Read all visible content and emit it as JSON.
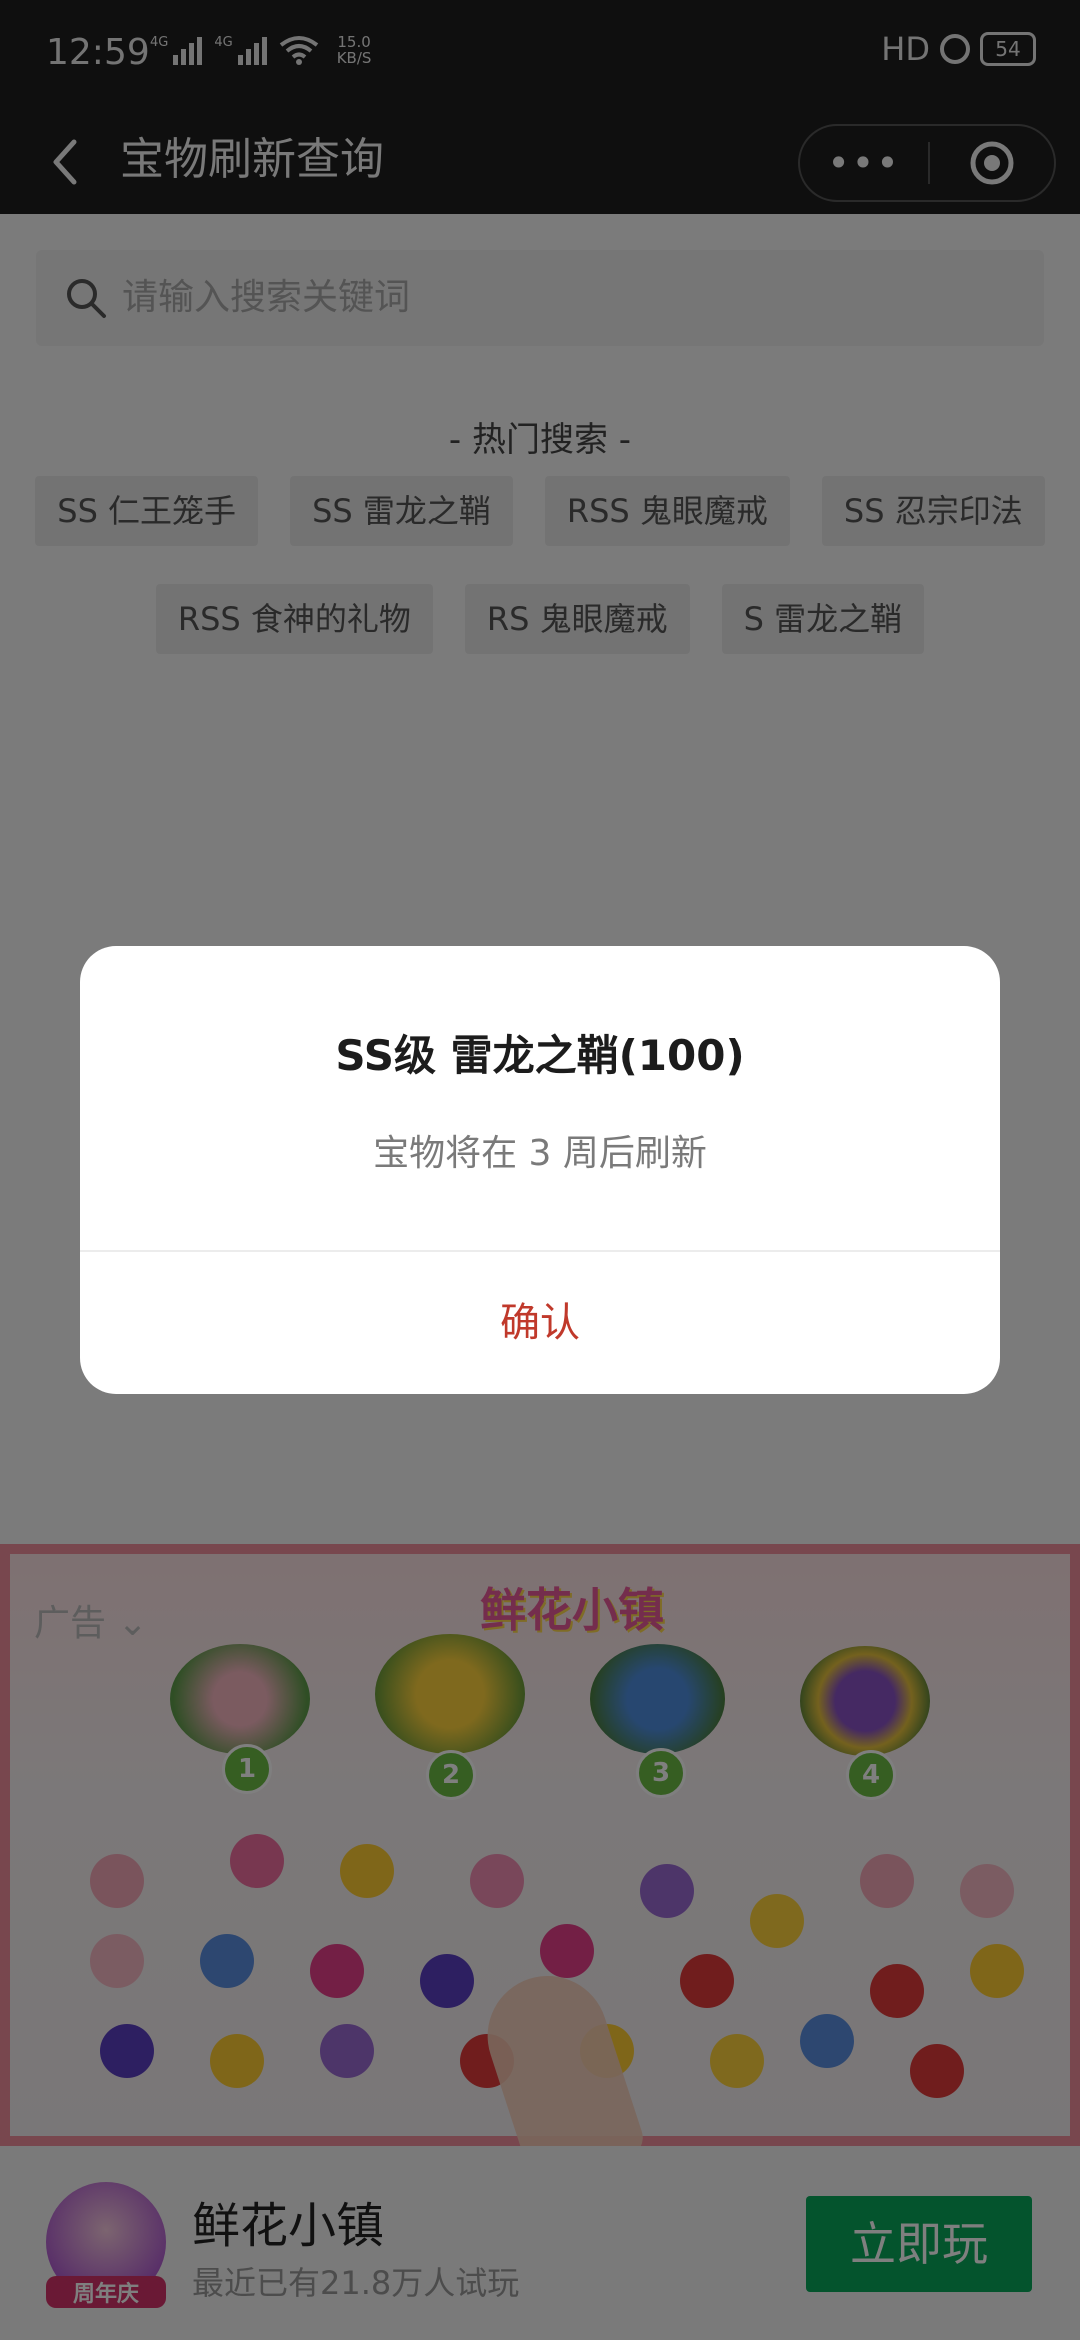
{
  "status_bar": {
    "time": "12:59",
    "network_1": "4G",
    "network_2": "4G",
    "speed_value": "15.0",
    "speed_unit": "KB/S",
    "hd": "HD",
    "battery": "54"
  },
  "nav": {
    "title": "宝物刷新查询",
    "more_label": "•••"
  },
  "search": {
    "placeholder": "请输入搜索关键词"
  },
  "hot_search": {
    "title": "- 热门搜索 -",
    "row1": [
      "SS 仁王笼手",
      "SS 雷龙之鞘",
      "RSS 鬼眼魔戒",
      "SS 忍宗印法"
    ],
    "row2": [
      "RSS 食神的礼物",
      "RS 鬼眼魔戒",
      "S 雷龙之鞘"
    ]
  },
  "ad": {
    "label": "广告",
    "logo": "鲜花小镇",
    "badges": [
      "1",
      "2",
      "3",
      "4"
    ]
  },
  "promo": {
    "name": "鲜花小镇",
    "subtitle": "最近已有21.8万人试玩",
    "badge": "周年庆",
    "button": "立即玩"
  },
  "dialog": {
    "title": "SS级 雷龙之鞘(100)",
    "message": "宝物将在 3 周后刷新",
    "confirm": "确认"
  },
  "colors": {
    "confirm": "#c0392b",
    "play_button": "#09a85a",
    "ad_border": "#f08f9c"
  }
}
